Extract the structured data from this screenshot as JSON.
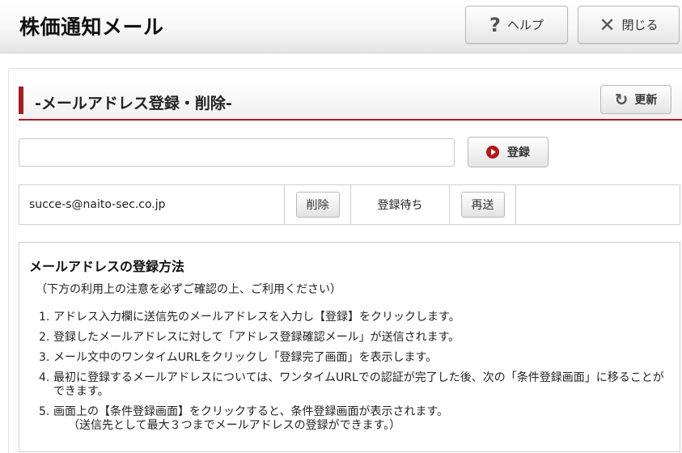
{
  "header": {
    "title": "株価通知メール",
    "help_label": "ヘルプ",
    "close_label": "閉じる",
    "help_icon": "?",
    "close_icon": "✕"
  },
  "section": {
    "title": "-メールアドレス登録・削除-",
    "refresh_label": "更新",
    "refresh_icon": "↻",
    "accent_color": "#a51d24"
  },
  "form": {
    "email_value": "",
    "register_label": "登録"
  },
  "registrations": [
    {
      "email": "succe-s@naito-sec.co.jp",
      "delete_label": "削除",
      "status": "登録待ち",
      "resend_label": "再送"
    }
  ],
  "info": {
    "title": "メールアドレスの登録方法",
    "note": "（下方の利用上の注意を必ずご確認の上、ご利用ください）",
    "steps": [
      {
        "num": "1.",
        "text": "アドレス入力欄に送信先のメールアドレスを入力し【登録】をクリックします。"
      },
      {
        "num": "2.",
        "text": "登録したメールアドレスに対して「アドレス登録確認メール」が送信されます。"
      },
      {
        "num": "3.",
        "text": "メール文中のワンタイムURLをクリックし「登録完了画面」を表示します。"
      },
      {
        "num": "4.",
        "text": "最初に登録するメールアドレスについては、ワンタイムURLでの認証が完了した後、次の「条件登録画面」に移ることができます。"
      },
      {
        "num": "5.",
        "text": "画面上の【条件登録画面】をクリックすると、条件登録画面が表示されます。",
        "sub": "（送信先として最大３つまでメールアドレスの登録ができます。）"
      }
    ]
  }
}
